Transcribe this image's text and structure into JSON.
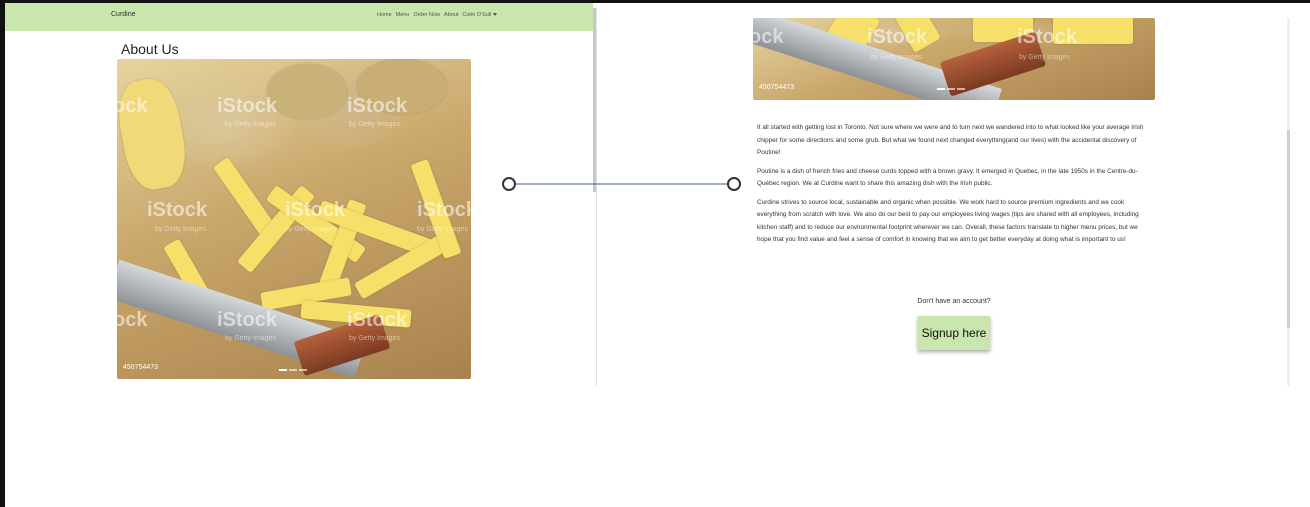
{
  "navbar": {
    "brand": "Curdine",
    "links": [
      "Home",
      "Menu",
      "Order Now",
      "About"
    ],
    "user_menu": "Colm O'Sull",
    "background": "#c8e6ad"
  },
  "page": {
    "title": "About Us"
  },
  "carousel": {
    "watermark": "iStock",
    "watermark_sub": "by Getty Images",
    "code": "450754473",
    "partial_left_watermark": "ock"
  },
  "about": {
    "paragraphs": [
      "It all started with getting lost in Toronto. Not sure where we were and to turn next we wandered into to what looked like your average Irish chipper for some directions and some grub. But what we found next changed everything(and our lives) with the accidental discovery of Poutine!",
      "Poutine is a dish of french fries and cheese curds topped with a brown gravy. It emerged in Quebec, in the late 1950s in the Centre-du-Québec region. We at Curdine want to share this amazing dish with the Irish public.",
      "Curdine strives to source local, sustainable and organic when possible. We work hard to source premium ingredients and we cook everything from scratch with love. We also do our best to pay our employees living wages (tips are shared with all employees, including kitchen staff) and to reduce our environmental footprint wherever we can. Overall, these factors translate to higher menu prices, but we hope that you find value and feel a sense of comfort in knowing that we aim to get better everyday at doing what is important to us!"
    ]
  },
  "signup": {
    "prompt": "Don't have an account?",
    "button_label": "Signup here",
    "accent": "#c8e6ad"
  },
  "icons": {
    "connector": "connector-line-icon",
    "dropdown": "caret-down-icon"
  }
}
